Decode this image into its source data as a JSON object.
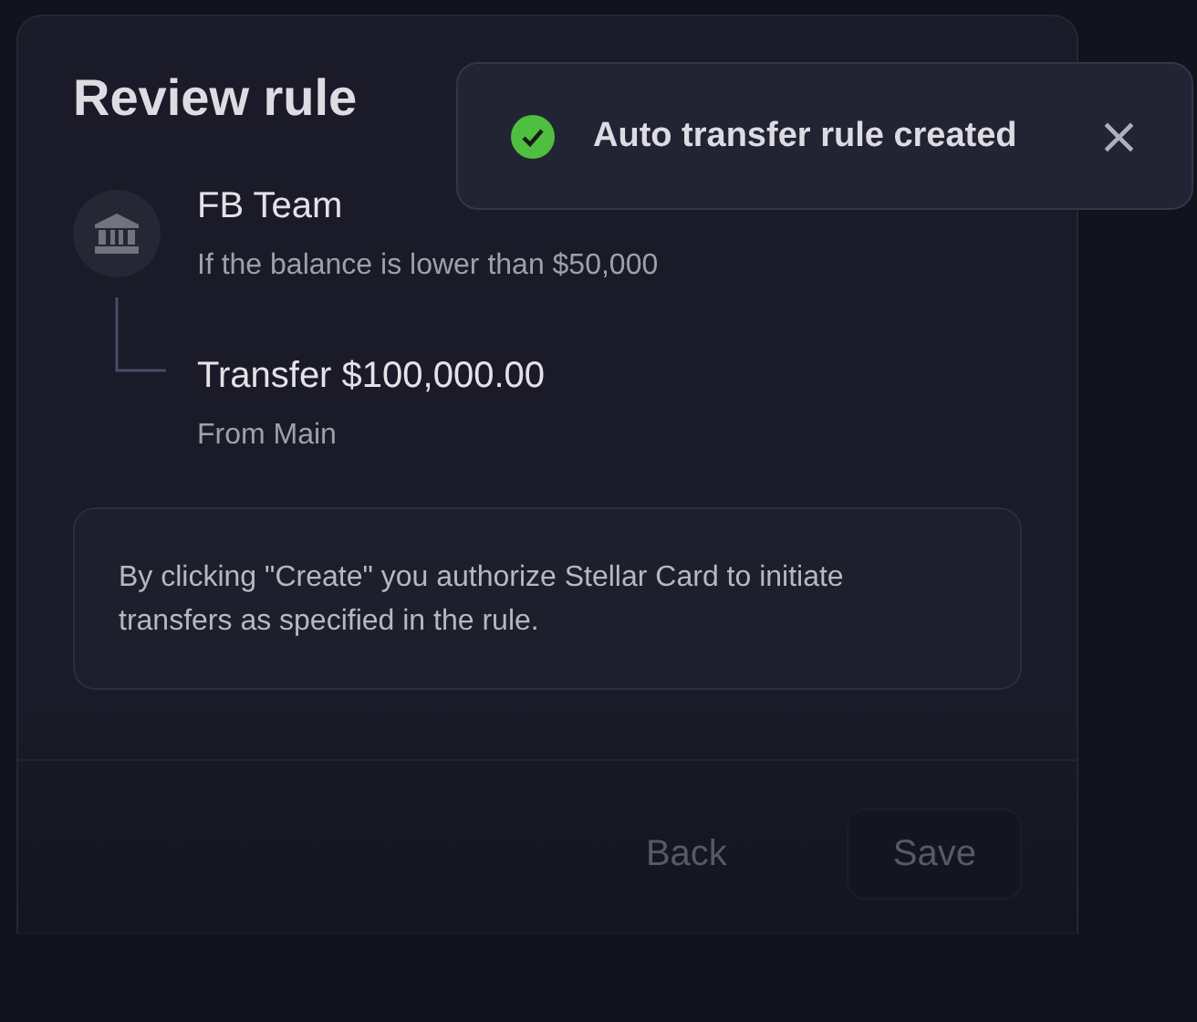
{
  "dialog": {
    "title": "Review rule",
    "rule": {
      "account": "FB Team",
      "condition": "If the balance is lower than $50,000",
      "action": "Transfer $100,000.00",
      "source": "From Main"
    },
    "notice": "By clicking \"Create\" you authorize Stellar Card to initiate transfers as specified in the rule.",
    "buttons": [
      {
        "label": "Back",
        "kind": "text",
        "disabled": true
      },
      {
        "label": "Save",
        "kind": "outlined",
        "disabled": true
      }
    ]
  },
  "toast": {
    "message": "Auto transfer rule created",
    "close": "×"
  }
}
